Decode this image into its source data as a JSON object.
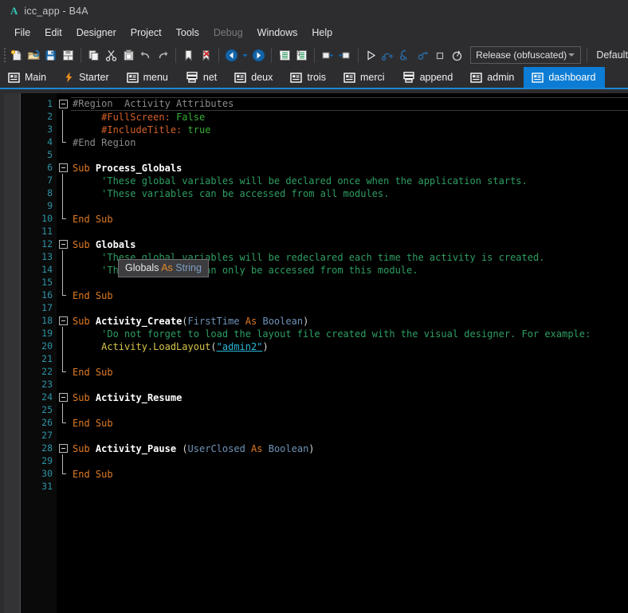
{
  "window": {
    "logo": "A",
    "title": "icc_app - B4A"
  },
  "menu": {
    "items": [
      {
        "label": "File",
        "enabled": true
      },
      {
        "label": "Edit",
        "enabled": true
      },
      {
        "label": "Designer",
        "enabled": true
      },
      {
        "label": "Project",
        "enabled": true
      },
      {
        "label": "Tools",
        "enabled": true
      },
      {
        "label": "Debug",
        "enabled": false
      },
      {
        "label": "Windows",
        "enabled": true
      },
      {
        "label": "Help",
        "enabled": true
      }
    ]
  },
  "toolbar": {
    "buttons": [
      {
        "name": "new-file-icon",
        "title": "New"
      },
      {
        "name": "open-folder-icon",
        "title": "Open"
      },
      {
        "name": "save-icon",
        "title": "Save"
      },
      {
        "name": "save-all-icon",
        "title": "Save All"
      },
      {
        "name": "copy-icon",
        "title": "Copy"
      },
      {
        "name": "cut-icon",
        "title": "Cut"
      },
      {
        "name": "paste-icon",
        "title": "Paste"
      },
      {
        "name": "undo-icon",
        "title": "Undo"
      },
      {
        "name": "redo-icon",
        "title": "Redo"
      },
      {
        "name": "bookmark-icon",
        "title": "Bookmark"
      },
      {
        "name": "clear-bookmark-icon",
        "title": "Clear Bookmarks"
      },
      {
        "name": "navigate-back-icon",
        "title": "Back"
      },
      {
        "name": "navigate-history-icon",
        "title": "History"
      },
      {
        "name": "navigate-forward-icon",
        "title": "Forward"
      },
      {
        "name": "indent-icon",
        "title": "Indent"
      },
      {
        "name": "outdent-icon",
        "title": "Outdent"
      },
      {
        "name": "comment-block-icon",
        "title": "Comment"
      },
      {
        "name": "uncomment-block-icon",
        "title": "Uncomment"
      },
      {
        "name": "run-icon",
        "title": "Run"
      },
      {
        "name": "step-over-icon",
        "title": "Step Over"
      },
      {
        "name": "step-into-icon",
        "title": "Step Into"
      },
      {
        "name": "step-out-icon",
        "title": "Step Out"
      },
      {
        "name": "stop-icon",
        "title": "Stop"
      },
      {
        "name": "restart-icon",
        "title": "Restart"
      }
    ],
    "build_config": "Release (obfuscated)",
    "variant": "Default"
  },
  "tabs": [
    {
      "label": "Main",
      "icon": "module-icon",
      "active": false
    },
    {
      "label": "Starter",
      "icon": "lightning-icon",
      "active": false
    },
    {
      "label": "menu",
      "icon": "module-icon",
      "active": false
    },
    {
      "label": "net",
      "icon": "service-icon",
      "active": false
    },
    {
      "label": "deux",
      "icon": "module-icon",
      "active": false
    },
    {
      "label": "trois",
      "icon": "module-icon",
      "active": false
    },
    {
      "label": "merci",
      "icon": "module-icon",
      "active": false
    },
    {
      "label": "append",
      "icon": "service-icon",
      "active": false
    },
    {
      "label": "admin",
      "icon": "module-icon",
      "active": false
    },
    {
      "label": "dashboard",
      "icon": "module-icon",
      "active": true
    }
  ],
  "editor": {
    "line_numbers": [
      1,
      2,
      3,
      4,
      5,
      6,
      7,
      8,
      9,
      10,
      11,
      12,
      13,
      14,
      15,
      16,
      17,
      18,
      19,
      20,
      21,
      22,
      23,
      24,
      25,
      26,
      27,
      28,
      29,
      30,
      31
    ],
    "lines": [
      {
        "n": 1,
        "text": "#Region  Activity Attributes"
      },
      {
        "n": 2,
        "text": "    #FullScreen: False"
      },
      {
        "n": 3,
        "text": "    #IncludeTitle: true"
      },
      {
        "n": 4,
        "text": "#End Region"
      },
      {
        "n": 5,
        "text": ""
      },
      {
        "n": 6,
        "text": "Sub Process_Globals"
      },
      {
        "n": 7,
        "text": "    'These global variables will be declared once when the application starts."
      },
      {
        "n": 8,
        "text": "    'These variables can be accessed from all modules."
      },
      {
        "n": 9,
        "text": ""
      },
      {
        "n": 10,
        "text": "End Sub"
      },
      {
        "n": 11,
        "text": ""
      },
      {
        "n": 12,
        "text": "Sub Globals"
      },
      {
        "n": 13,
        "text": "    'These global variables will be redeclared each time the activity is created."
      },
      {
        "n": 14,
        "text": "    'These variables can only be accessed from this module."
      },
      {
        "n": 15,
        "text": ""
      },
      {
        "n": 16,
        "text": "End Sub"
      },
      {
        "n": 17,
        "text": ""
      },
      {
        "n": 18,
        "text": "Sub Activity_Create(FirstTime As Boolean)"
      },
      {
        "n": 19,
        "text": "    'Do not forget to load the layout file created with the visual designer. For example:"
      },
      {
        "n": 20,
        "text": "    Activity.LoadLayout(\"admin2\")"
      },
      {
        "n": 21,
        "text": ""
      },
      {
        "n": 22,
        "text": "End Sub"
      },
      {
        "n": 23,
        "text": ""
      },
      {
        "n": 24,
        "text": "Sub Activity_Resume"
      },
      {
        "n": 25,
        "text": ""
      },
      {
        "n": 26,
        "text": "End Sub"
      },
      {
        "n": 27,
        "text": ""
      },
      {
        "n": 28,
        "text": "Sub Activity_Pause (UserClosed As Boolean)"
      },
      {
        "n": 29,
        "text": ""
      },
      {
        "n": 30,
        "text": "End Sub"
      },
      {
        "n": 31,
        "text": ""
      }
    ],
    "tokens": {
      "region": "#Region",
      "region_title": "Activity Attributes",
      "fullscreen_key": "#FullScreen:",
      "fullscreen_val": "False",
      "includetitle_key": "#IncludeTitle:",
      "includetitle_val": "true",
      "end_region": "#End Region",
      "sub": "Sub",
      "end_sub": "End Sub",
      "process_globals": "Process_Globals",
      "globals": "Globals",
      "activity_create": "Activity_Create",
      "activity_resume": "Activity_Resume",
      "activity_pause": "Activity_Pause",
      "comment_7": "'These global variables will be declared once when the application starts.",
      "comment_8": "'These variables can be accessed from all modules.",
      "comment_13": "'These global variables will be redeclared each time the activity is created.",
      "comment_14": "'These variables can only be accessed from this module.",
      "comment_19": "'Do not forget to load the layout file created with the visual designer. For example:",
      "first_time": "FirstTime",
      "user_closed": "UserClosed",
      "as": "As",
      "boolean": "Boolean",
      "activity_loadlayout": "Activity.LoadLayout",
      "layout_name": "\"admin2\"",
      "paren_open": "(",
      "paren_close": ")",
      "paren_close2": ")"
    }
  },
  "tooltip": {
    "name": "Globals",
    "as": "As",
    "type": "String"
  },
  "colors": {
    "accent": "#0c7cd5",
    "keyword": "#e07b24",
    "comment": "#2f9e63",
    "string": "#2bb6d6",
    "type": "#6f93b8",
    "function": "#d7c64a",
    "line_number": "#2c93a6",
    "editor_bg": "#000000",
    "chrome_bg": "#2d2d30"
  }
}
